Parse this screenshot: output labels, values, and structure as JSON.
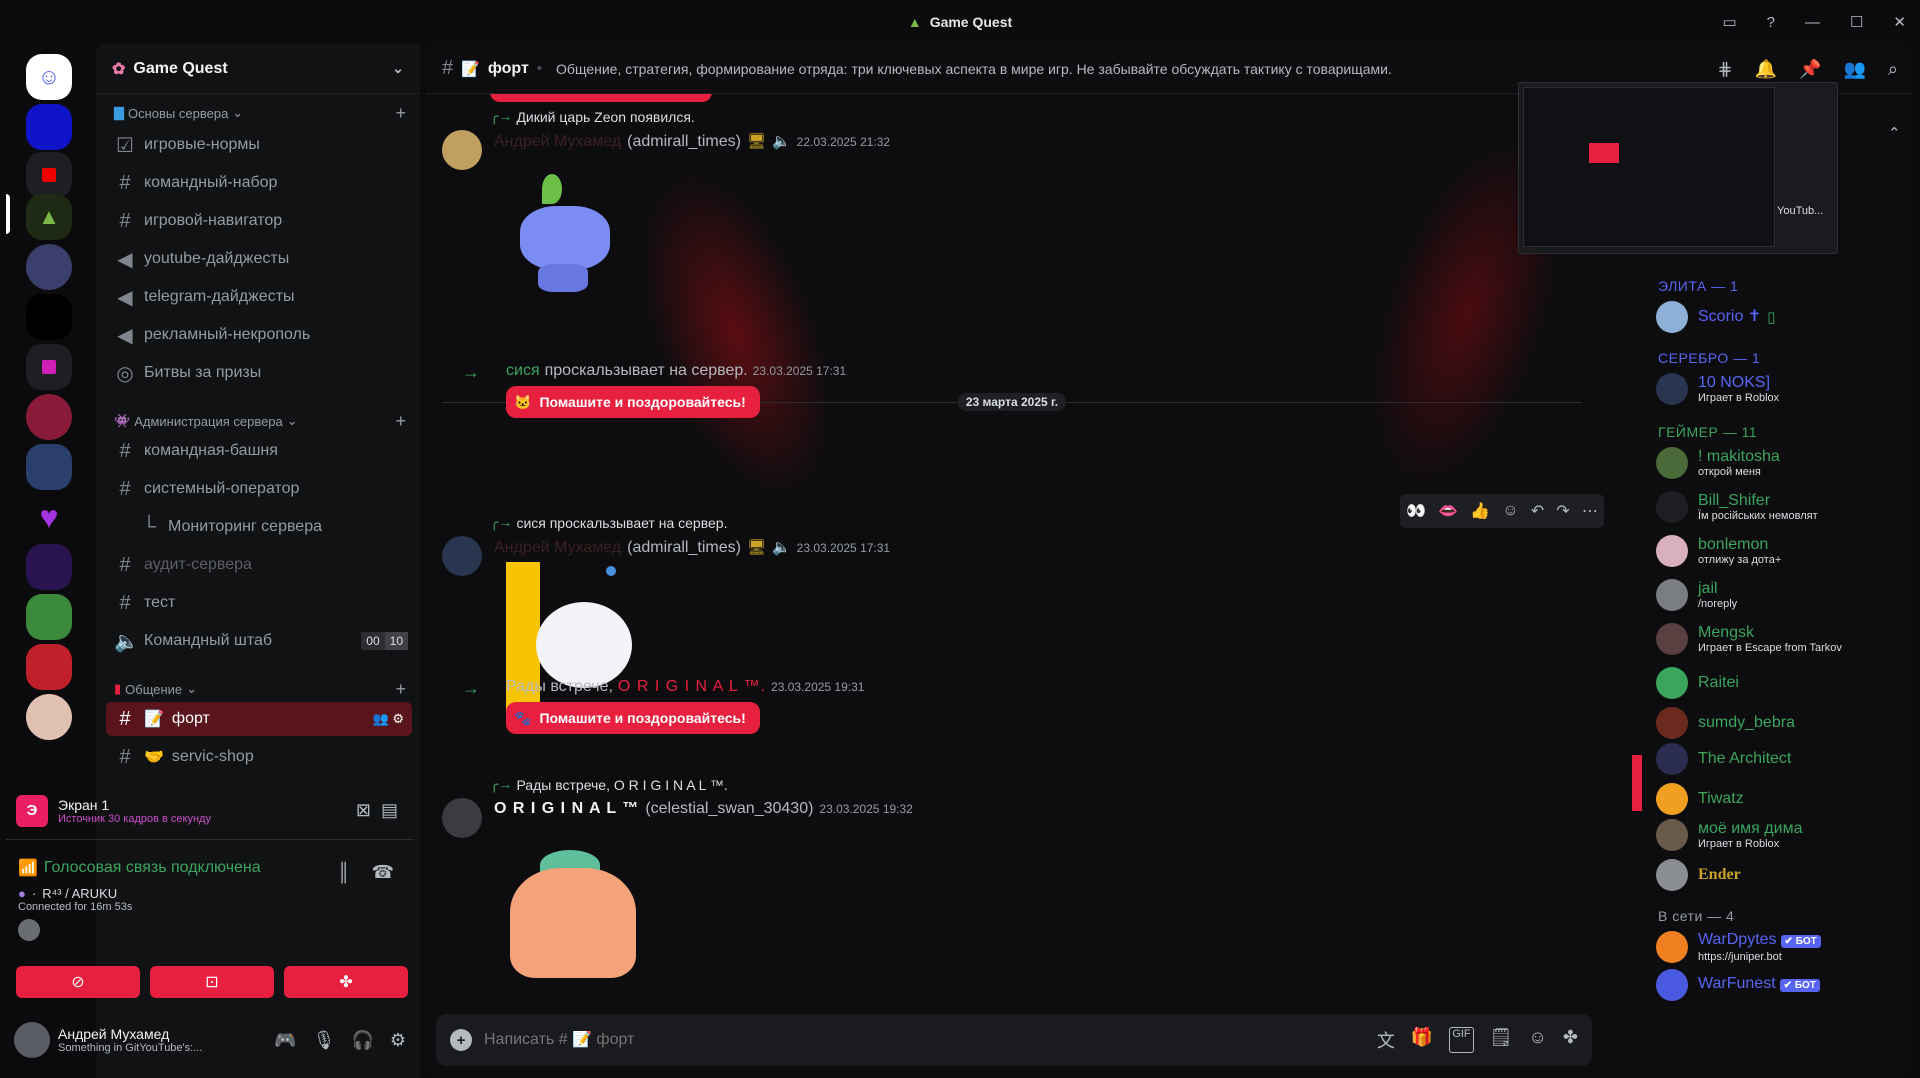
{
  "window": {
    "title": "Game Quest"
  },
  "server": {
    "name": "Game Quest"
  },
  "categories": [
    {
      "label": "Основы сервера"
    },
    {
      "label": "Администрация сервера"
    },
    {
      "label": "Общение"
    }
  ],
  "channels": [
    {
      "label": "игровые-нормы"
    },
    {
      "label": "командный-набор"
    },
    {
      "label": "игровой-навигатор"
    },
    {
      "label": "youtube-дайджесты"
    },
    {
      "label": "telegram-дайджесты"
    },
    {
      "label": "рекламный-некрополь"
    },
    {
      "label": "Битвы за призы"
    },
    {
      "label": "командная-башня"
    },
    {
      "label": "системный-оператор"
    },
    {
      "label": "Мониторинг сервера"
    },
    {
      "label": "аудит-сервера"
    },
    {
      "label": "тест"
    },
    {
      "label": "Командный штаб",
      "count_a": "00",
      "count_b": "10"
    },
    {
      "label": "форт"
    },
    {
      "label": "servic-shop"
    }
  ],
  "screen_share": {
    "title": "Экран 1",
    "subtitle": "Источник 30 кадров в секунду"
  },
  "voice": {
    "status": "Голосовая связь подключена",
    "channel": "R⁴³ / ARUKU",
    "duration": "Connected for 16m 53s"
  },
  "user": {
    "name": "Андрей Мухамед",
    "status": "Something in GitYouTube's:..."
  },
  "current_channel": {
    "name": "форт",
    "topic": "Общение, стратегия, формирование отряда: три ключевых аспекта в мире игр. Не забывайте обсуждать тактику с товарищами."
  },
  "messages": {
    "m1_reply": "Дикий царь Zeon появился.",
    "m1_user": "Андрей Мухамед",
    "m1_handle": "(admirall_times)",
    "m1_ts": "22.03.2025 21:32",
    "date_divider": "23 марта 2025 г.",
    "j1_user": "сися",
    "j1_text": "проскальзывает на сервер.",
    "j1_ts": "23.03.2025 17:31",
    "wave_label": "Помашите и поздоровайтесь!",
    "m2_reply": "сися проскальзывает на сервер.",
    "m2_user": "Андрей Мухамед",
    "m2_handle": "(admirall_times)",
    "m2_ts": "23.03.2025 17:31",
    "j2_text": "Рады встрече,",
    "j2_user": "O R I G I N A L ™.",
    "j2_ts": "23.03.2025 19:31",
    "m3_reply": "Рады встрече, O R I G I N A L ™.",
    "m3_user": "O R I G I N A L ™",
    "m3_handle": "(celestial_swan_30430)",
    "m3_ts": "23.03.2025 19:32"
  },
  "composer": {
    "placeholder": "Написать # 📝 форт"
  },
  "pip_label": "YouTub...",
  "members": {
    "groups": [
      {
        "label": "ЭЛИТА — 1"
      },
      {
        "label": "СЕРЕБРО — 1"
      },
      {
        "label": "ГЕЙМЕР — 11"
      },
      {
        "label": "В сети — 4"
      }
    ],
    "list": [
      {
        "name": "Scorio ✝",
        "activity": "",
        "color": "#5865f2"
      },
      {
        "name": "10 NOKS]",
        "activity": "Играет в Roblox",
        "color": "#5865f2"
      },
      {
        "name": "! makitosha",
        "activity": "открой меня",
        "color": "#3ba55d"
      },
      {
        "name": "Bill_Shifer",
        "activity": "Їм російських немовлят",
        "color": "#3ba55d"
      },
      {
        "name": "bonlemon",
        "activity": "отлижу за дота+",
        "color": "#3ba55d"
      },
      {
        "name": "jail",
        "activity": "/noreply",
        "color": "#3ba55d"
      },
      {
        "name": "Mengsk",
        "activity": "Играет в Escape from Tarkov",
        "color": "#3ba55d"
      },
      {
        "name": "Raitei",
        "activity": "",
        "color": "#3ba55d"
      },
      {
        "name": "sumdy_bebra",
        "activity": "",
        "color": "#3ba55d"
      },
      {
        "name": "The Architect",
        "activity": "",
        "color": "#3ba55d"
      },
      {
        "name": "Tiwatz",
        "activity": "",
        "color": "#3ba55d"
      },
      {
        "name": "моё имя дима",
        "activity": "Играет в Roblox",
        "color": "#3ba55d"
      },
      {
        "name": "Ender",
        "activity": "",
        "color": "#c9a227"
      },
      {
        "name": "WarDpytes",
        "activity": "https://juniper.bot",
        "color": "#5865f2",
        "badge": "✔ БОТ"
      },
      {
        "name": "WarFunest",
        "activity": "",
        "color": "#5865f2",
        "badge": "✔ БОТ"
      }
    ]
  },
  "colors": {
    "accent": "#e8203f",
    "voice_green": "#3ba55d",
    "group_blue": "#5865f2"
  }
}
